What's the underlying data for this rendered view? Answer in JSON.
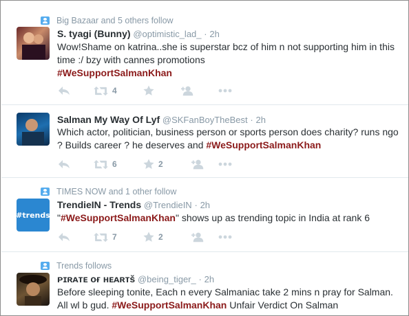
{
  "colors": {
    "hashtag": "#8b1a1a",
    "context_icon": "#55acee",
    "icon_gray": "#ccd6dd",
    "meta_gray": "#8899a6"
  },
  "tweets": [
    {
      "context": "Big Bazaar and 5 others follow",
      "name": "S. tyagi (Bunny)",
      "handle": "@optimistic_lad_",
      "dot": "·",
      "time": "2h",
      "text": "Wow!Shame on katrina..she is superstar bcz of him n not supporting him in this time :/ bzy with cannes promotions",
      "hashtag": "#WeSupportSalmanKhan",
      "retweets": "4",
      "favorites": ""
    },
    {
      "context": "",
      "name": "Salman My Way Of Lyf",
      "handle": "@SKFanBoyTheBest",
      "dot": "·",
      "time": "2h",
      "text": "Which actor, politician, business person or sports person does charity? runs ngo ? Builds career ? he deserves and ",
      "hashtag": "#WeSupportSalmanKhan",
      "retweets": "6",
      "favorites": "2"
    },
    {
      "context": "TIMES NOW and 1 other follow",
      "name": "TrendieIN - Trends",
      "handle": "@TrendieIN",
      "dot": "·",
      "time": "2h",
      "text_before": "\"",
      "hashtag": "#WeSupportSalmanKhan",
      "text_after": "\" shows up as trending topic in India at rank 6",
      "retweets": "7",
      "favorites": "2",
      "avatar_text": "#trends"
    },
    {
      "context": "Trends follows",
      "name": "ᴘɪʀᴀᴛᴇ ᴏғ ʜᴇᴀʀᴛš",
      "handle": "@being_tiger_",
      "dot": "·",
      "time": "2h",
      "text": "Before sleeping tonite, Each n every Salmaniac take 2 mins n pray for Salman. All wl b gud. ",
      "hashtag": "#WeSupportSalmanKhan",
      "text_after": " Unfair Verdict On Salman"
    }
  ]
}
